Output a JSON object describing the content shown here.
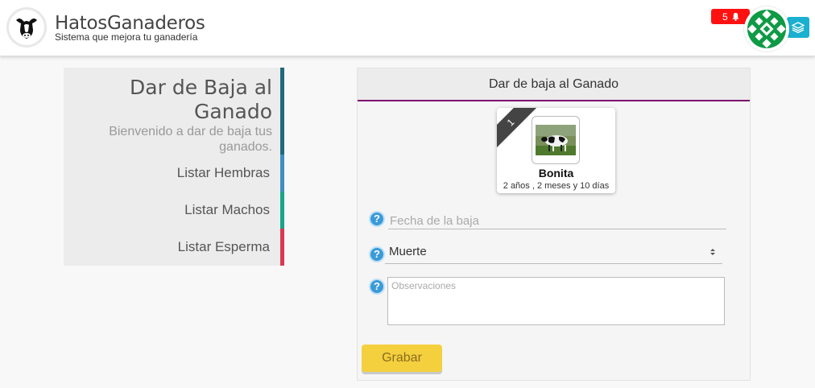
{
  "header": {
    "brand_title": "HatosGanaderos",
    "brand_subtitle": "Sistema que mejora tu ganadería",
    "notification_count": "5",
    "logo_icon": "cow-head-icon",
    "notification_icon": "bell-icon",
    "layers_icon": "layers-icon"
  },
  "sidebar": {
    "title": "Dar de Baja al Ganado",
    "welcome": "Bienvenido a dar de baja tus ganados.",
    "items": [
      {
        "label": "Listar Hembras",
        "color": "#3e8ec4"
      },
      {
        "label": "Listar Machos",
        "color": "#17a589"
      },
      {
        "label": "Listar Esperma",
        "color": "#d9394e"
      }
    ],
    "head_color": "#1e6a7c"
  },
  "panel": {
    "title": "Dar de baja al Ganado",
    "accent_color": "#7b0f6e",
    "animal": {
      "index": "1",
      "name": "Bonita",
      "age": "2 años , 2 meses y 10 días"
    },
    "form": {
      "date_placeholder": "Fecha de la baja",
      "reason_value": "Muerte",
      "notes_placeholder": "Observaciones",
      "help_symbol": "?",
      "submit_label": "Grabar"
    }
  },
  "colors": {
    "notification_bg": "#ff1111",
    "layers_bg": "#1ab0d0",
    "submit_bg": "#f4d03f",
    "help_bg": "#3a9ad9"
  }
}
